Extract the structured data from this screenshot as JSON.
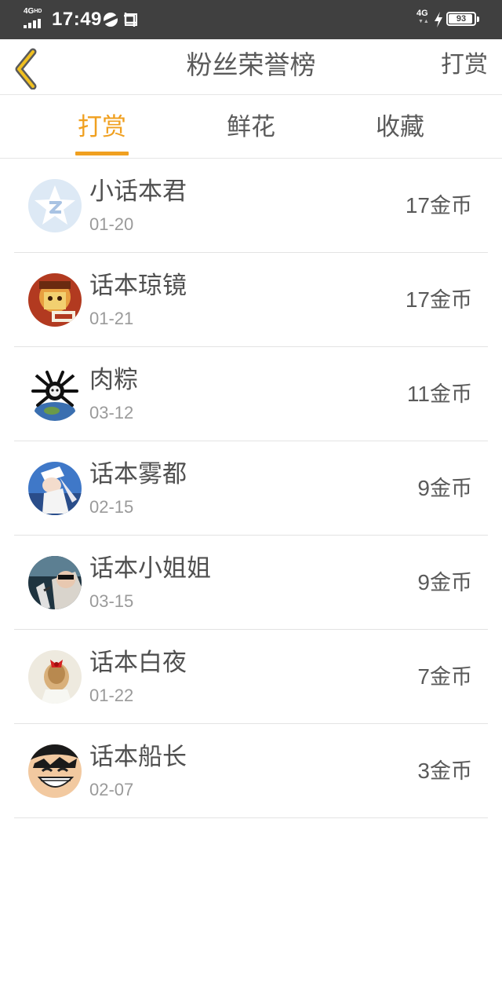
{
  "status_bar": {
    "network_left": "4G",
    "network_left_sup": "HD",
    "time": "17:49",
    "network_right": "4G",
    "battery_level": "93"
  },
  "header": {
    "title": "粉丝荣誉榜",
    "back_icon": "chevron-left-icon",
    "right_action": "打赏"
  },
  "tabs": [
    {
      "label": "打赏",
      "active": true
    },
    {
      "label": "鲜花",
      "active": false
    },
    {
      "label": "收藏",
      "active": false
    }
  ],
  "accent_color": "#f0a020",
  "fans": [
    {
      "name": "小话本君",
      "date": "01-20",
      "amount": "17",
      "unit": "金币",
      "avatar": "blue-star-logo"
    },
    {
      "name": "话本琼镜",
      "date": "01-21",
      "amount": "17",
      "unit": "金币",
      "avatar": "cartoon-character"
    },
    {
      "name": "肉粽",
      "date": "03-12",
      "amount": "11",
      "unit": "金币",
      "avatar": "spider-globe"
    },
    {
      "name": "话本雾都",
      "date": "02-15",
      "amount": "9",
      "unit": "金币",
      "avatar": "anime-thief"
    },
    {
      "name": "话本小姐姐",
      "date": "03-15",
      "amount": "9",
      "unit": "金币",
      "avatar": "selfie-photo"
    },
    {
      "name": "话本白夜",
      "date": "01-22",
      "amount": "7",
      "unit": "金币",
      "avatar": "girl-red-bow"
    },
    {
      "name": "话本船长",
      "date": "02-07",
      "amount": "3",
      "unit": "金币",
      "avatar": "laughing-pirate"
    }
  ]
}
